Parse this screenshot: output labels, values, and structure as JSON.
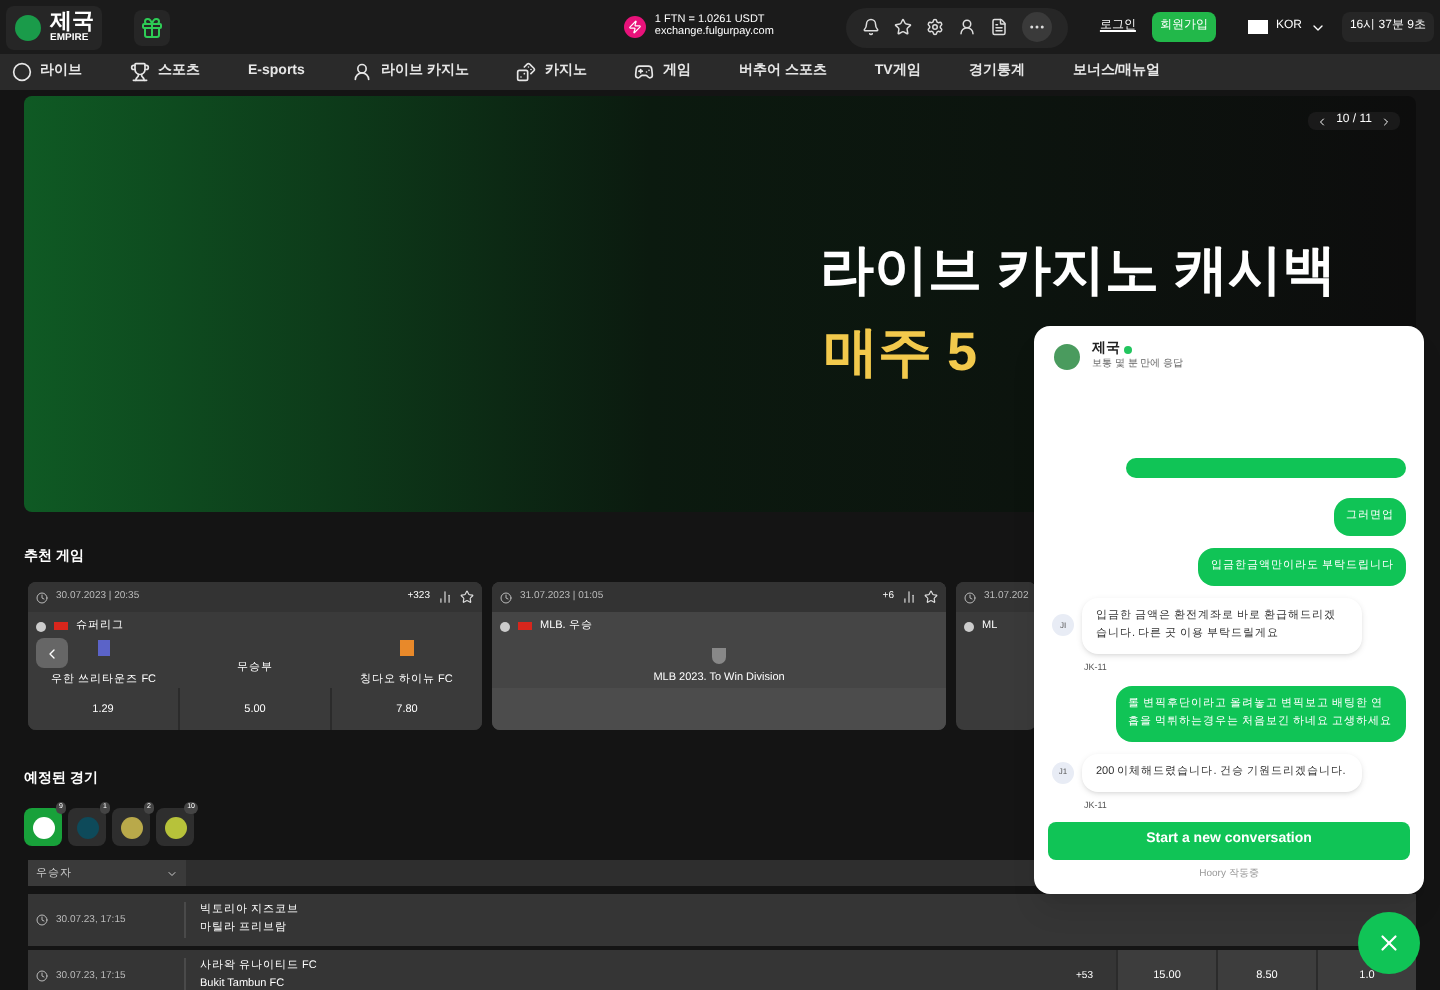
{
  "header": {
    "logo_title": "제국",
    "logo_subtitle": "EMPIRE",
    "rate": "1 FTN = 1.0261 USDT",
    "rate_site": "exchange.fulgurpay.com",
    "login": "로그인",
    "signup": "회원가입",
    "language": "KOR",
    "clock": "16시 37분 9초"
  },
  "nav": [
    {
      "label": "라이브"
    },
    {
      "label": "스포츠"
    },
    {
      "label": "E-sports"
    },
    {
      "label": "라이브 카지노"
    },
    {
      "label": "카지노"
    },
    {
      "label": "게임"
    },
    {
      "label": "버추어 스포츠"
    },
    {
      "label": "TV게임"
    },
    {
      "label": "경기통계"
    },
    {
      "label": "보너스/매뉴얼"
    }
  ],
  "banner": {
    "headline": "라이브 카지노 캐시백",
    "subline": "매주 5",
    "counter": "10 / 11"
  },
  "featured": {
    "title": "추천 게임",
    "cards": [
      {
        "kind": "match",
        "time": "30.07.2023 | 20:35",
        "more": "+323",
        "league": "슈퍼리그",
        "home": "우한 쓰리타운즈 FC",
        "draw": "무승부",
        "away": "칭다오 하이뉴 FC",
        "odds": [
          "1.29",
          "5.00",
          "7.80"
        ]
      },
      {
        "kind": "outright",
        "time": "31.07.2023 | 01:05",
        "more": "+6",
        "league": "MLB. 우승",
        "event": "MLB 2023. To Win Division"
      },
      {
        "kind": "partial",
        "time": "31.07.202",
        "league": "ML"
      }
    ]
  },
  "upcoming": {
    "title": "예정된 경기",
    "sports": [
      {
        "count": "9",
        "selected": true
      },
      {
        "count": "1",
        "selected": false
      },
      {
        "count": "2",
        "selected": false
      },
      {
        "count": "10",
        "selected": false
      }
    ],
    "filter": "우승자",
    "rows": [
      {
        "time": "30.07.23, 17:15",
        "home": "빅토리아 지즈코브",
        "away": "마틸라 프리브람"
      },
      {
        "time": "30.07.23, 17:15",
        "home": "사라왁 유나이티드 FC",
        "away": "Bukit Tambun FC",
        "more": "+53",
        "odds": [
          "15.00",
          "8.50",
          "1.0"
        ]
      }
    ]
  },
  "chat": {
    "name": "제국",
    "online": true,
    "status": "보통 몇 분 만에 응답",
    "messages": [
      {
        "kind": "user"
      },
      {
        "kind": "user",
        "text": "그러면업"
      },
      {
        "kind": "user",
        "text": "입금한금액만이라도 부탁드립니다"
      },
      {
        "kind": "agent",
        "text": "입금한 금액은 환전계좌로 바로 환급해드리겠습니다. 다른 곳 이용 부탁드릴게요",
        "avatar": "JI",
        "sender": "JK-11"
      },
      {
        "kind": "user",
        "text": "롤 변픽후단이라고 올려놓고 변픽보고 배팅한 연흡을 먹튀하는경우는 처음보긴 하네요 고생하세요"
      },
      {
        "kind": "agent",
        "text": "200 이체해드렸습니다. 건승 기원드리겠습니다.",
        "avatar": "J1",
        "sender": "JK-11"
      }
    ],
    "button": "Start a new conversation",
    "powered": "Hoory 작동중"
  }
}
